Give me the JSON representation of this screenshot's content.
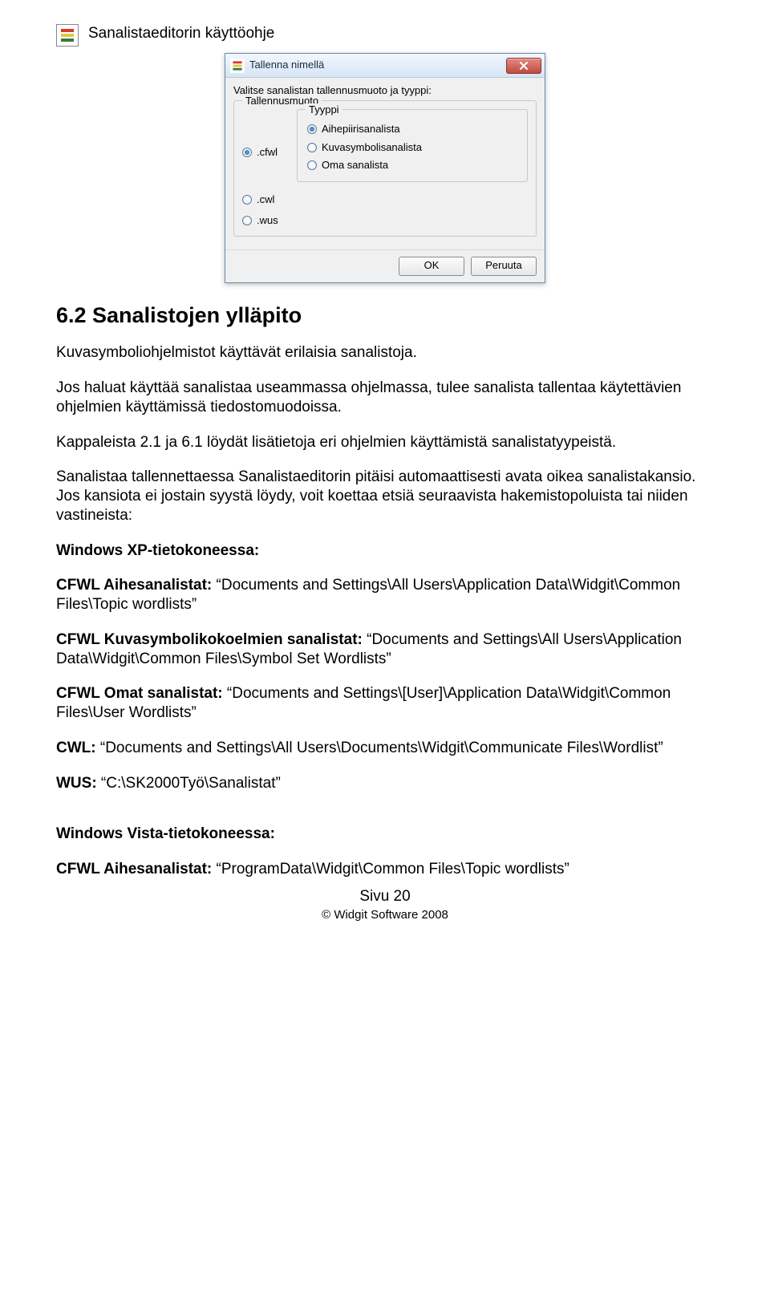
{
  "header": {
    "title": "Sanalistaeditorin käyttöohje"
  },
  "dialog": {
    "title": "Tallenna nimellä",
    "instruction": "Valitse sanalistan tallennusmuoto ja tyyppi:",
    "format_group_label": "Tallennusmuoto",
    "type_group_label": "Tyyppi",
    "formats": {
      "cfwl": ".cfwl",
      "cwl": ".cwl",
      "wus": ".wus"
    },
    "types": {
      "aihe": "Aihepiirisanalista",
      "kuva": "Kuvasymbolisanalista",
      "oma": "Oma sanalista"
    },
    "buttons": {
      "ok": "OK",
      "cancel": "Peruuta"
    }
  },
  "section_heading": "6.2 Sanalistojen ylläpito",
  "para1": "Kuvasymboliohjelmistot käyttävät erilaisia sanalistoja.",
  "para2": "Jos haluat käyttää sanalistaa useammassa ohjelmassa, tulee sanalista tallentaa käytettävien ohjelmien käyttämissä tiedostomuodoissa.",
  "para3": "Kappaleista 2.1 ja 6.1 löydät lisätietoja eri ohjelmien käyttämistä sanalistatyypeistä.",
  "para4": "Sanalistaa tallennettaessa Sanalistaeditorin pitäisi automaattisesti avata oikea sanalistakansio. Jos kansiota ei jostain syystä löydy, voit koettaa etsiä seuraavista hakemistopoluista tai niiden vastineista:",
  "xp_heading": "Windows XP-tietokoneessa:",
  "items": {
    "aihe_label": "CFWL Aihesanalistat:",
    "aihe_path": " “Documents and Settings\\All Users\\Application Data\\Widgit\\Common Files\\Topic wordlists”",
    "kuva_label": "CFWL Kuvasymbolikokoelmien sanalistat:",
    "kuva_path": " “Documents and Settings\\All Users\\Application Data\\Widgit\\Common Files\\Symbol Set Wordlists”",
    "omat_label": "CFWL Omat sanalistat:",
    "omat_path": " “Documents and Settings\\[User]\\Application Data\\Widgit\\Common Files\\User Wordlists”",
    "cwl_label": "CWL:",
    "cwl_path": " “Documents and Settings\\All Users\\Documents\\Widgit\\Communicate Files\\Wordlist”",
    "wus_label": "WUS:",
    "wus_path": " “C:\\SK2000Työ\\Sanalistat”"
  },
  "vista_heading": "Windows Vista-tietokoneessa:",
  "vista_item_label": "CFWL Aihesanalistat:",
  "vista_item_path": " “ProgramData\\Widgit\\Common Files\\Topic wordlists”",
  "footer_page": "Sivu 20",
  "footer_copy": "© Widgit Software 2008"
}
